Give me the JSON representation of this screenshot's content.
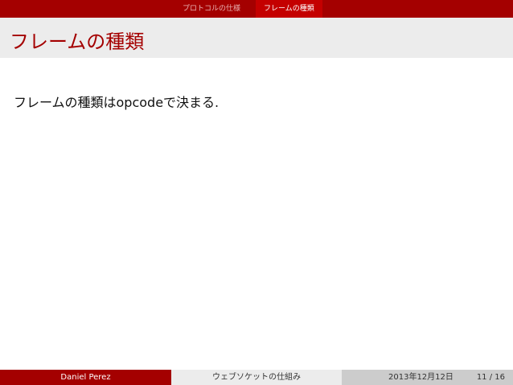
{
  "nav": {
    "sections": [
      {
        "label": "プロトコルの仕様",
        "active": false
      },
      {
        "label": "フレームの種類",
        "active": true
      }
    ]
  },
  "frame": {
    "title": "フレームの種類",
    "body": "フレームの種類はopcodeで決まる."
  },
  "footer": {
    "author": "Daniel Perez",
    "talk_title": "ウェブソケットの仕組み",
    "date": "2013年12月12日",
    "page": "11 / 16"
  },
  "colors": {
    "accent": "#a40000",
    "title_band": "#ececec",
    "footer_mid": "#ececec",
    "footer_right": "#cccccc"
  }
}
